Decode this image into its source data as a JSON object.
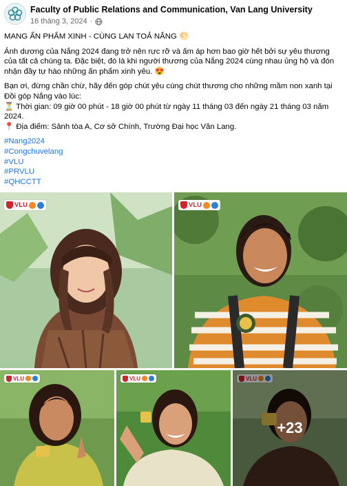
{
  "header": {
    "page_name": "Faculty of Public Relations and Communication, Van Lang University",
    "date": "16 tháng 3, 2024",
    "separator": "·"
  },
  "post": {
    "title": "MANG ẤN PHẨM XINH - CÙNG LAN TOẢ NẮNG 🌕",
    "intro": "Ánh dương của Nắng 2024 đang trở nên rực rỡ và ấm áp hơn bao giờ hết bởi sự yêu thương của tất cả chúng ta. Đặc biệt, đó là khi người thương của Nắng 2024 cùng nhau ủng hộ và đón nhận đầy tự hào những ấn phẩm xinh yêu. 😍",
    "invite": "Bạn ơi, đừng chần chừ, hãy đến góp chút yêu cùng chút thương cho những mầm non xanh tại Đồi góp Nắng vào lúc:",
    "time": "⏳ Thời gian: 09 giờ 00 phút - 18 giờ 00 phút từ ngày 11 tháng 03 đến ngày 21 tháng 03 năm 2024.",
    "place": "📍 Địa điểm: Sảnh tòa A, Cơ sở Chính, Trường Đại học Văn Lang.",
    "hashtags": [
      "#Nang2024",
      "#Congchuvelang",
      "#VLU",
      "#PRVLU",
      "#QHCCTT"
    ]
  },
  "gallery": {
    "badge_text": "VLU",
    "more_count": "+23",
    "colors": {
      "badge_red": "#d3232b",
      "badge_orange": "#f08a24",
      "badge_blue": "#2f7fd8",
      "link_blue": "#1b74e4"
    }
  }
}
